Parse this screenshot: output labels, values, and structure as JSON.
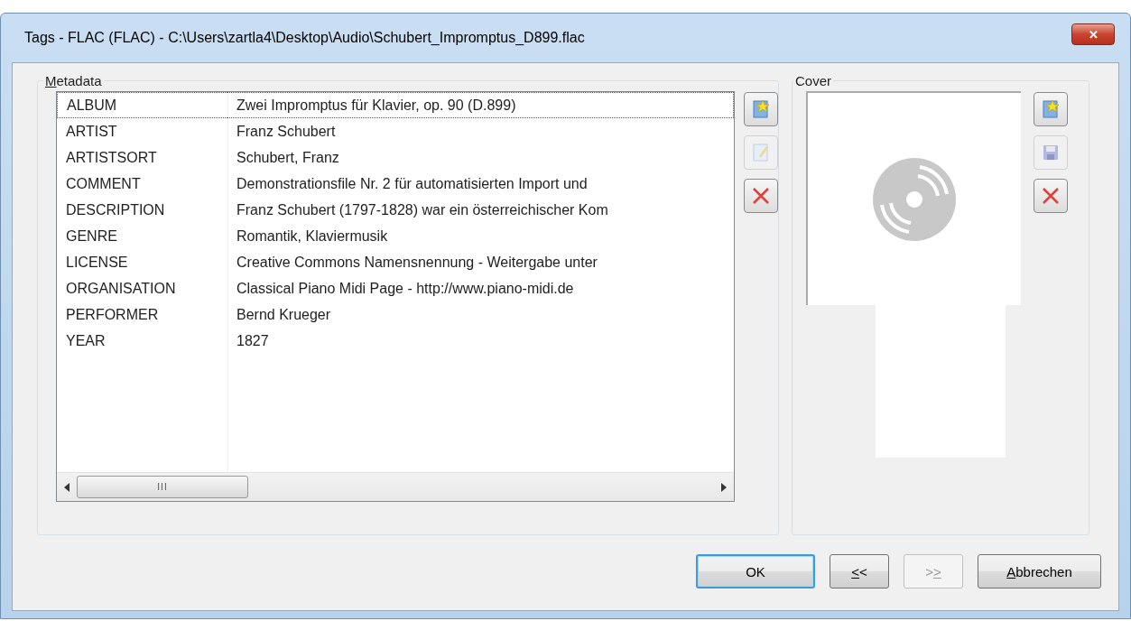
{
  "window": {
    "title": "Tags - FLAC (FLAC) - C:\\Users\\zartla4\\Desktop\\Audio\\Schubert_Impromptus_D899.flac",
    "close": "✕"
  },
  "metadata": {
    "title": {
      "access_key": "M",
      "after": "etadata"
    },
    "rows": [
      {
        "name": "ALBUM",
        "value": "Zwei Impromptus für Klavier, op. 90 (D.899)",
        "focused": true
      },
      {
        "name": "ARTIST",
        "value": "Franz Schubert",
        "focused": false
      },
      {
        "name": "ARTISTSORT",
        "value": "Schubert, Franz",
        "focused": false
      },
      {
        "name": "COMMENT",
        "value": "Demonstrationsfile Nr. 2 für automatisierten Import und",
        "focused": false
      },
      {
        "name": "DESCRIPTION",
        "value": "Franz Schubert (1797-1828) war ein österreichischer Kom",
        "focused": false
      },
      {
        "name": "GENRE",
        "value": "Romantik, Klaviermusik",
        "focused": false
      },
      {
        "name": "LICENSE",
        "value": "Creative Commons Namensnennung - Weitergabe unter",
        "focused": false
      },
      {
        "name": "ORGANISATION",
        "value": "Classical Piano Midi Page - http://www.piano-midi.de",
        "focused": false
      },
      {
        "name": "PERFORMER",
        "value": "Bernd Krueger",
        "focused": false
      },
      {
        "name": "YEAR",
        "value": "1827",
        "focused": false
      }
    ],
    "scroll_grip": "III",
    "tools": [
      {
        "kind": "add",
        "disabled": false
      },
      {
        "kind": "edit",
        "disabled": true
      },
      {
        "kind": "delete",
        "disabled": false
      }
    ]
  },
  "cover": {
    "title": "Cover",
    "tools": [
      {
        "kind": "add",
        "disabled": false
      },
      {
        "kind": "save",
        "disabled": true
      },
      {
        "kind": "delete",
        "disabled": false
      }
    ]
  },
  "buttons": [
    {
      "label": {
        "before": "OK"
      },
      "default": true,
      "disabled": false
    },
    {
      "label": {
        "access_key": "<",
        "after": "<"
      },
      "default": false,
      "disabled": false
    },
    {
      "label": {
        "before": ">",
        "access_key": ">"
      },
      "default": false,
      "disabled": true
    },
    {
      "label": {
        "access_key": "A",
        "after": "bbrechen"
      },
      "default": false,
      "disabled": false
    }
  ]
}
